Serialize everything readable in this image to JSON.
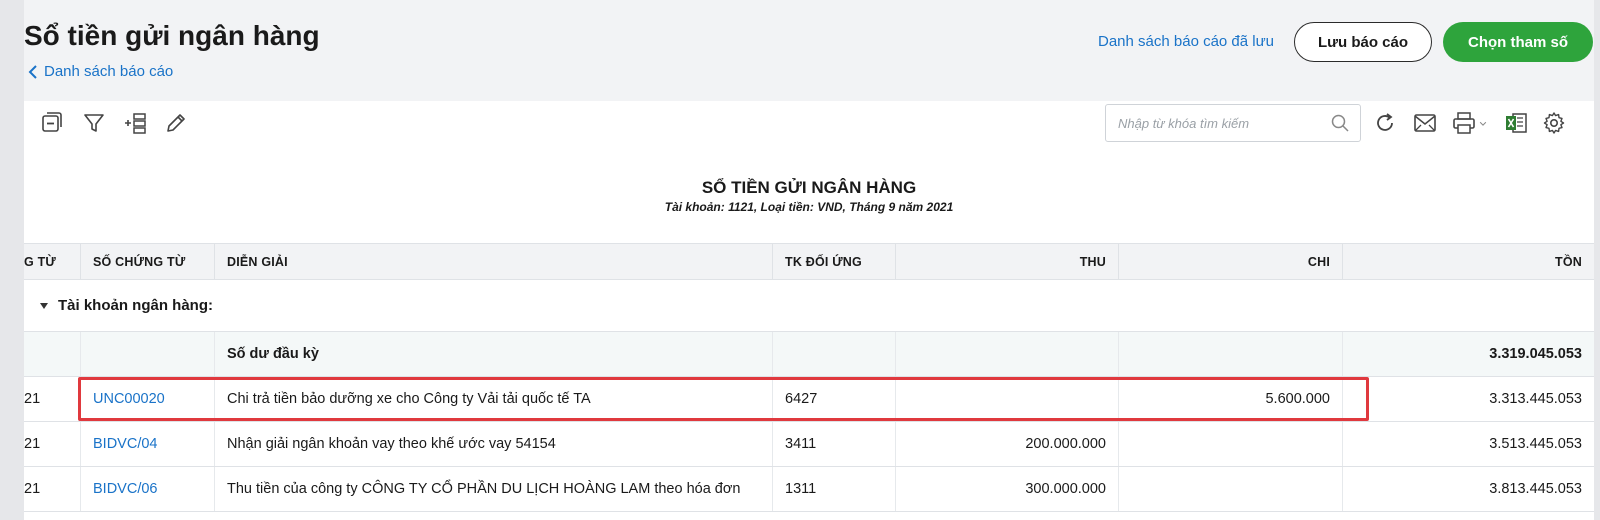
{
  "header": {
    "title": "Sổ tiền gửi ngân hàng",
    "back_link": "Danh sách báo cáo",
    "saved_reports_link": "Danh sách báo cáo đã lưu",
    "save_button": "Lưu báo cáo",
    "params_button": "Chọn tham số"
  },
  "toolbar": {
    "icons": [
      "collapse-icon",
      "filter-icon",
      "add-column-icon",
      "edit-icon",
      "refresh-icon",
      "email-icon",
      "print-icon",
      "excel-icon",
      "settings-icon"
    ],
    "search_placeholder": "Nhập từ khóa tìm kiếm"
  },
  "report": {
    "title": "SỔ TIỀN GỬI NGÂN HÀNG",
    "subtitle": "Tài khoản: 1121, Loại tiền: VND, Tháng 9 năm 2021"
  },
  "table": {
    "columns": [
      "G TỪ",
      "SỐ CHỨNG TỪ",
      "DIỄN GIẢI",
      "TK ĐỐI ỨNG",
      "THU",
      "CHI",
      "TỒN"
    ],
    "group_label": "Tài khoản ngân hàng:",
    "opening": {
      "label": "Số dư đầu kỳ",
      "balance": "3.319.045.053"
    },
    "rows": [
      {
        "date": "21",
        "voucher": "UNC00020",
        "desc": "Chi trả tiền bảo dưỡng xe cho Công ty Vải tải quốc tế TA",
        "account": "6427",
        "thu": "",
        "chi": "5.600.000",
        "ton": "3.313.445.053"
      },
      {
        "date": "21",
        "voucher": "BIDVC/04",
        "desc": "Nhận giải ngân khoản vay theo khế ước vay 54154",
        "account": "3411",
        "thu": "200.000.000",
        "chi": "",
        "ton": "3.513.445.053"
      },
      {
        "date": "21",
        "voucher": "BIDVC/06",
        "desc": "Thu tiền của công ty CÔNG TY CỔ PHẦN DU LỊCH HOÀNG LAM theo hóa đơn",
        "account": "1311",
        "thu": "300.000.000",
        "chi": "",
        "ton": "3.813.445.053"
      }
    ]
  },
  "colors": {
    "accent_green": "#2ea43c",
    "link_blue": "#1a73c8",
    "highlight_red": "#e0393e"
  }
}
